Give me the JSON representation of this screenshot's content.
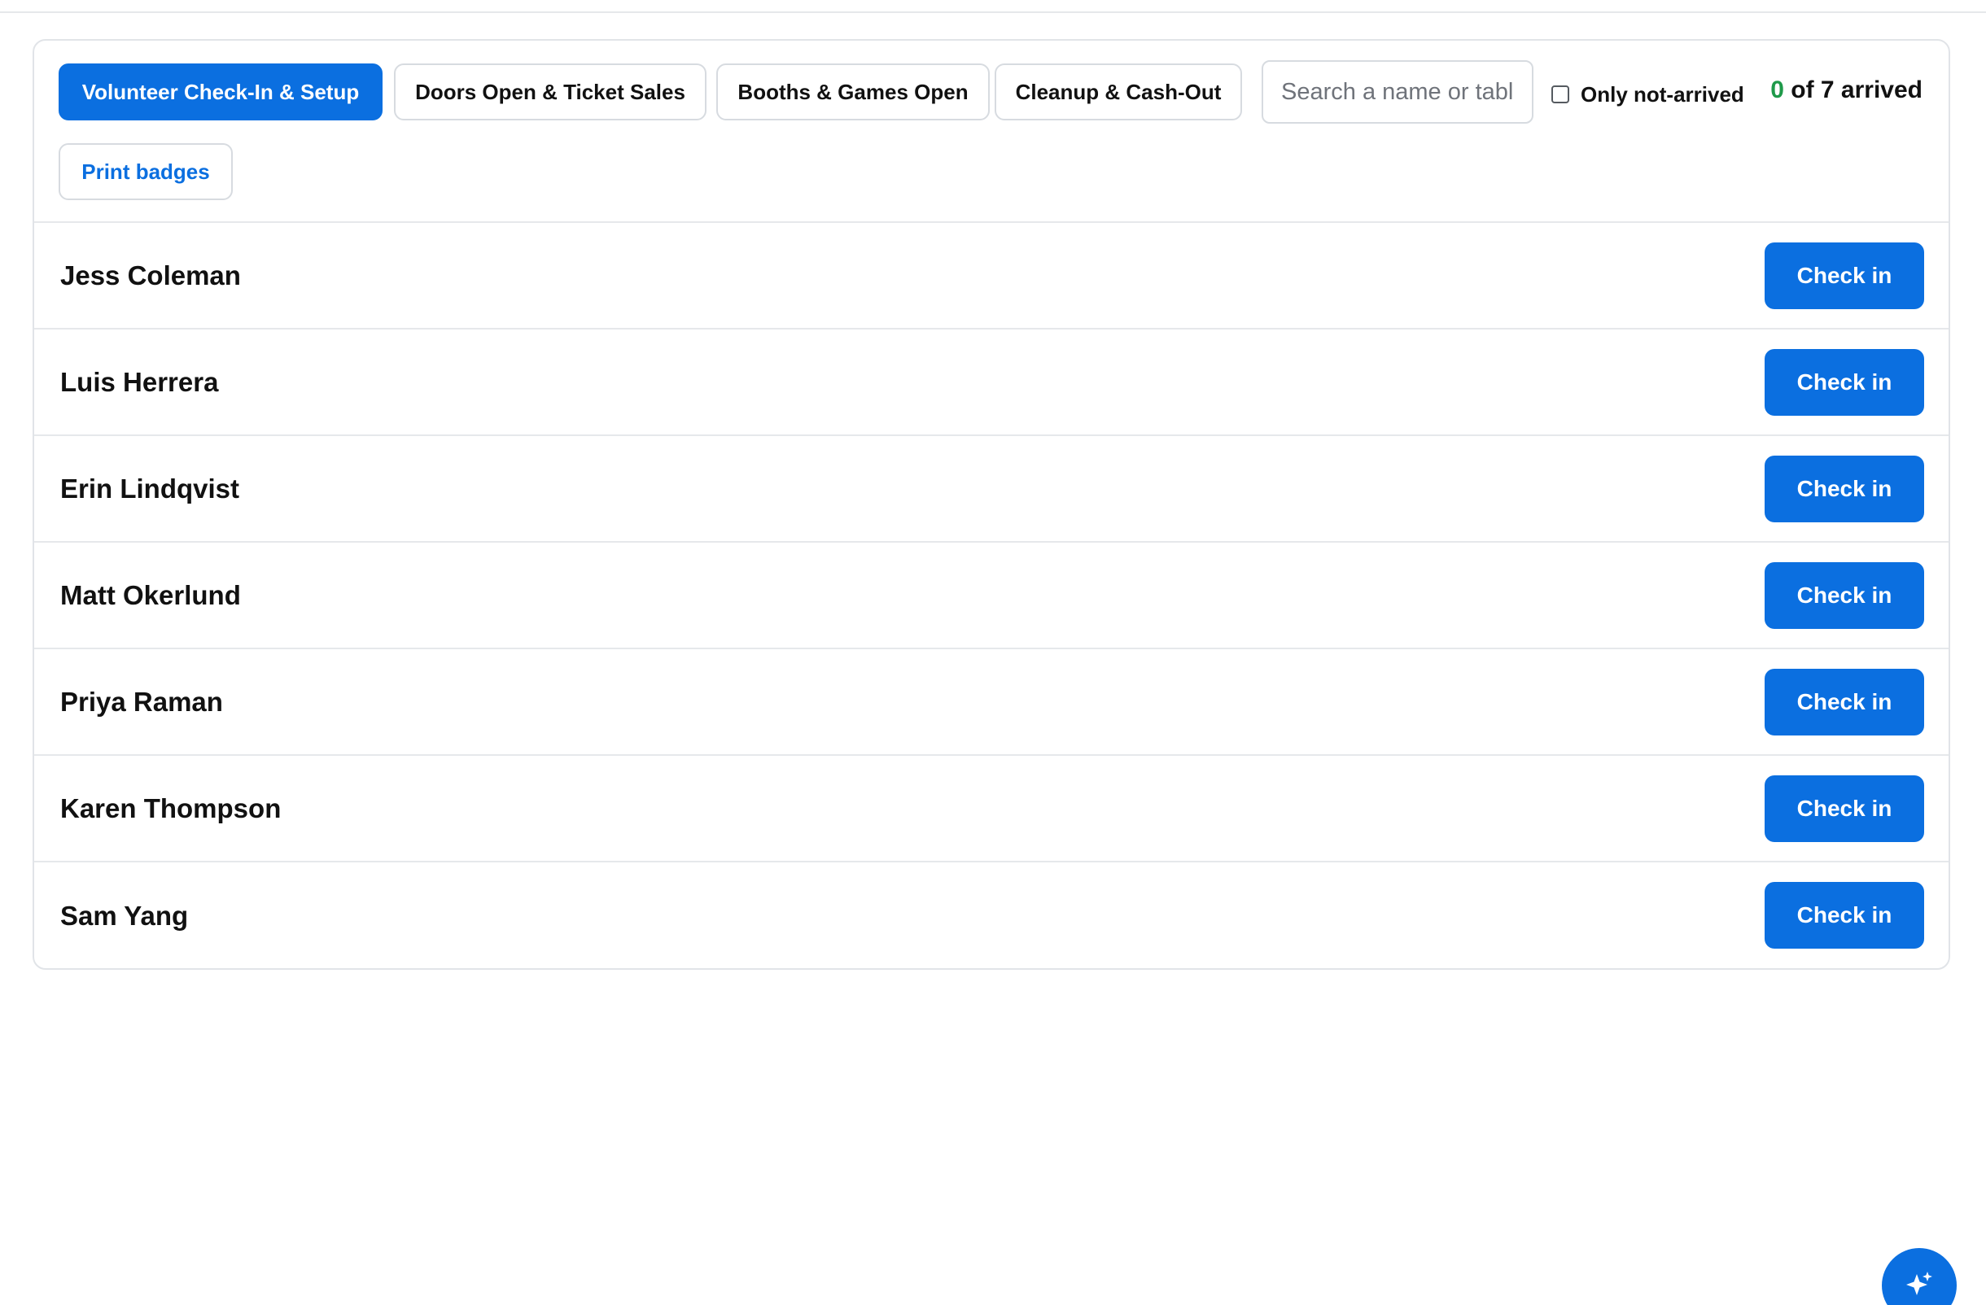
{
  "tabs": [
    {
      "label": "Volunteer Check-In & Setup",
      "active": true
    },
    {
      "label": "Doors Open & Ticket Sales",
      "active": false
    },
    {
      "label": "Booths & Games Open",
      "active": false
    },
    {
      "label": "Cleanup & Cash-Out",
      "active": false
    }
  ],
  "search": {
    "placeholder": "Search a name or table"
  },
  "filter": {
    "label": "Only not-arrived",
    "checked": false
  },
  "summary": {
    "arrived_count": "0",
    "arrived_rest": " of 7 arrived"
  },
  "print_label": "Print badges",
  "volunteers": [
    {
      "name": "Jess Coleman",
      "action": "Check in"
    },
    {
      "name": "Luis Herrera",
      "action": "Check in"
    },
    {
      "name": "Erin Lindqvist",
      "action": "Check in"
    },
    {
      "name": "Matt Okerlund",
      "action": "Check in"
    },
    {
      "name": "Priya Raman",
      "action": "Check in"
    },
    {
      "name": "Karen Thompson",
      "action": "Check in"
    },
    {
      "name": "Sam Yang",
      "action": "Check in"
    }
  ],
  "fab": {
    "icon": "sparkle-icon"
  },
  "colors": {
    "accent": "#0b6fe0",
    "arrived_count": "#1f9a4a"
  }
}
